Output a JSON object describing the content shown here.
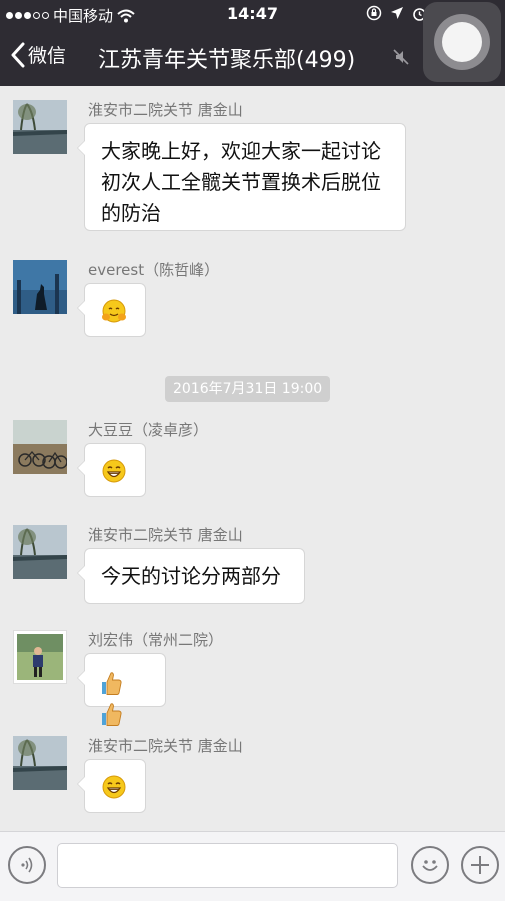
{
  "status_bar": {
    "carrier": "中国移动",
    "time": "14:47"
  },
  "nav": {
    "back_label": "微信",
    "title": "江苏青年关节聚乐部(499)"
  },
  "chat": {
    "timestamp": "2016年7月31日 19:00",
    "messages": [
      {
        "sender": "淮安市二院关节  唐金山",
        "text": "大家晚上好，欢迎大家一起讨论初次人工全髋关节置换术后脱位的防治",
        "avatar": "lake-avatar"
      },
      {
        "sender": "everest（陈哲峰）",
        "emoji": "hug-emoji",
        "avatar": "wolf-avatar"
      },
      {
        "sender": "大豆豆（凌卓彦）",
        "emoji": "grin-emoji",
        "avatar": "bicycles-avatar"
      },
      {
        "sender": "淮安市二院关节  唐金山",
        "text": "今天的讨论分两部分",
        "avatar": "lake-avatar"
      },
      {
        "sender": "刘宏伟（常州二院）",
        "emoji": "thumbs-up-emoji x2",
        "avatar": "person-avatar"
      },
      {
        "sender": "淮安市二院关节  唐金山",
        "emoji": "grin-emoji",
        "avatar": "lake-avatar"
      }
    ]
  },
  "input_bar": {
    "placeholder": "",
    "icons": [
      "voice-icon",
      "emoji-icon",
      "plus-icon"
    ]
  },
  "colors": {
    "header_bg": "#2e2c33",
    "chat_bg": "#ebebeb",
    "bubble_bg": "#ffffff"
  }
}
